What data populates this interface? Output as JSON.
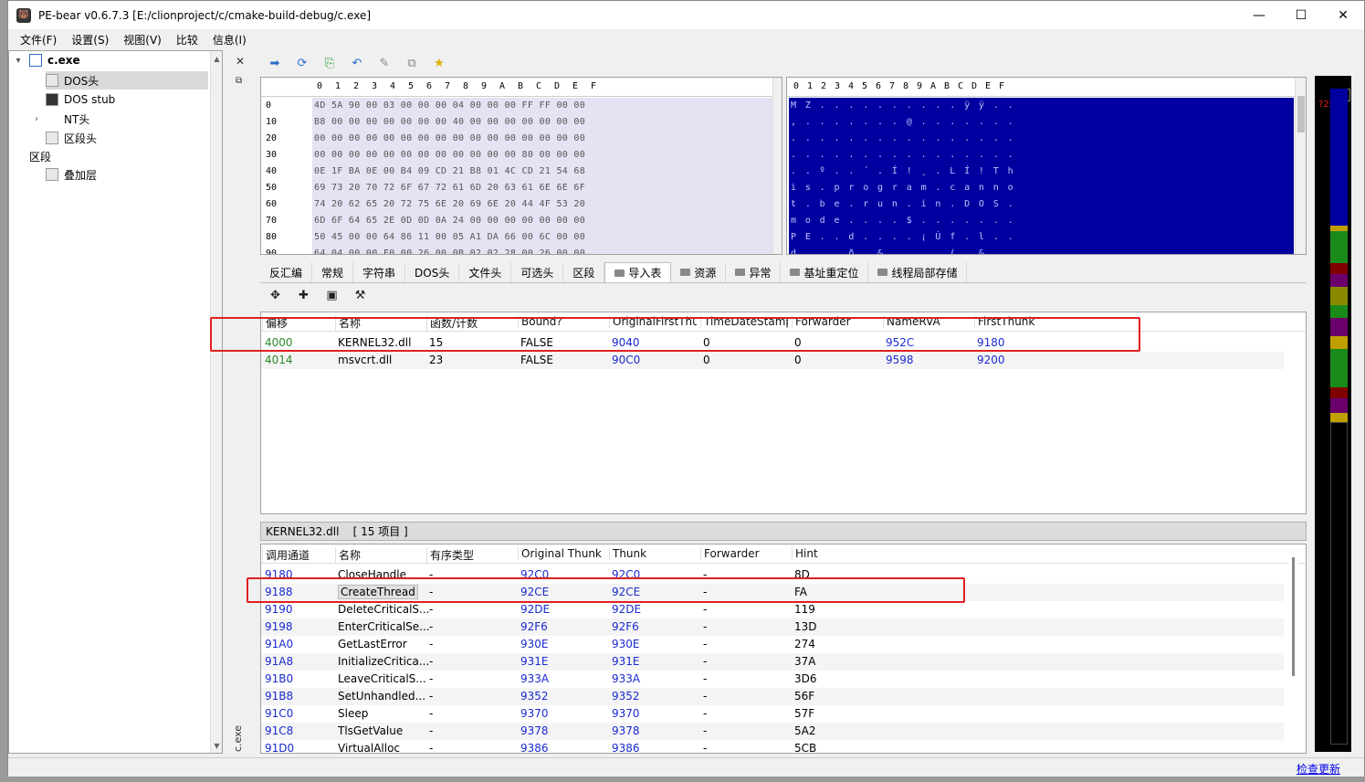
{
  "window": {
    "title": "PE-bear v0.6.7.3 [E:/clionproject/c/cmake-build-debug/c.exe]",
    "minimize": "—",
    "maximize": "☐",
    "close": "✕"
  },
  "menu": [
    "文件(F)",
    "设置(S)",
    "视图(V)",
    "比较",
    "信息(I)"
  ],
  "tree": {
    "root": "c.exe",
    "items": [
      "DOS头",
      "DOS stub",
      "NT头",
      "区段头",
      "区段",
      "叠加层"
    ]
  },
  "side": {
    "vertical_label": "c.exe",
    "close": "✕",
    "float": "⧉"
  },
  "hex": {
    "columns": [
      "0",
      "1",
      "2",
      "3",
      "4",
      "5",
      "6",
      "7",
      "8",
      "9",
      "A",
      "B",
      "C",
      "D",
      "E",
      "F"
    ],
    "rows": [
      {
        "off": "0",
        "bytes": "4D 5A 90 00 03 00 00 00 04 00 00 00 FF FF 00 00",
        "ascii": "M Z . . . . . . . . . . ÿ ÿ . ."
      },
      {
        "off": "10",
        "bytes": "B8 00 00 00 00 00 00 00 40 00 00 00 00 00 00 00",
        "ascii": ", . . . . . . . @ . . . . . . ."
      },
      {
        "off": "20",
        "bytes": "00 00 00 00 00 00 00 00 00 00 00 00 00 00 00 00",
        "ascii": ". . . . . . . . . . . . . . . ."
      },
      {
        "off": "30",
        "bytes": "00 00 00 00 00 00 00 00 00 00 00 00 80 00 00 00",
        "ascii": ". . . . . . . . . . . . . . . ."
      },
      {
        "off": "40",
        "bytes": "0E 1F BA 0E 00 B4 09 CD 21 B8 01 4C CD 21 54 68",
        "ascii": ". . º . . ´ . Í ! ¸ . L Í ! T h"
      },
      {
        "off": "50",
        "bytes": "69 73 20 70 72 6F 67 72 61 6D 20 63 61 6E 6E 6F",
        "ascii": "i s . p r o g r a m . c a n n o"
      },
      {
        "off": "60",
        "bytes": "74 20 62 65 20 72 75 6E 20 69 6E 20 44 4F 53 20",
        "ascii": "t . b e . r u n . i n . D O S ."
      },
      {
        "off": "70",
        "bytes": "6D 6F 64 65 2E 0D 0D 0A 24 00 00 00 00 00 00 00",
        "ascii": "m o d e . . . . $ . . . . . . ."
      },
      {
        "off": "80",
        "bytes": "50 45 00 00 64 86 11 00 05 A1 DA 66 00 6C 00 00",
        "ascii": "P E . . d . . . . ¡ Ú f . l . ."
      },
      {
        "off": "90",
        "bytes": "64 04 00 00 F0 00 26 00 0B 02 02 28 00 26 00 00",
        "ascii": "d . . . ð . & . . . . ( . & . ."
      }
    ]
  },
  "tabs": [
    "反汇编",
    "常规",
    "字符串",
    "DOS头",
    "文件头",
    "可选头",
    "区段",
    "导入表",
    "资源",
    "异常",
    "基址重定位",
    "线程局部存储"
  ],
  "active_tab": "导入表",
  "imports": {
    "headers": [
      "偏移",
      "名称",
      "函数/计数",
      "Bound?",
      "OriginalFirstThu",
      "TimeDateStamp",
      "Forwarder",
      "NameRVA",
      "FirstThunk"
    ],
    "rows": [
      [
        "4000",
        "KERNEL32.dll",
        "15",
        "FALSE",
        "9040",
        "0",
        "0",
        "952C",
        "9180"
      ],
      [
        "4014",
        "msvcrt.dll",
        "23",
        "FALSE",
        "90C0",
        "0",
        "0",
        "9598",
        "9200"
      ]
    ]
  },
  "sub_header": "KERNEL32.dll    [ 15 项目 ]",
  "funcs": {
    "headers": [
      "调用通道",
      "名称",
      "有序类型",
      "Original Thunk",
      "Thunk",
      "Forwarder",
      "Hint"
    ],
    "rows": [
      [
        "9180",
        "CloseHandle",
        "-",
        "92C0",
        "92C0",
        "-",
        "8D"
      ],
      [
        "9188",
        "CreateThread",
        "-",
        "92CE",
        "92CE",
        "-",
        "FA"
      ],
      [
        "9190",
        "DeleteCriticalS...",
        "-",
        "92DE",
        "92DE",
        "-",
        "119"
      ],
      [
        "9198",
        "EnterCriticalSe...",
        "-",
        "92F6",
        "92F6",
        "-",
        "13D"
      ],
      [
        "91A0",
        "GetLastError",
        "-",
        "930E",
        "930E",
        "-",
        "274"
      ],
      [
        "91A8",
        "InitializeCritica...",
        "-",
        "931E",
        "931E",
        "-",
        "37A"
      ],
      [
        "91B0",
        "LeaveCriticalS...",
        "-",
        "933A",
        "933A",
        "-",
        "3D6"
      ],
      [
        "91B8",
        "SetUnhandled...",
        "-",
        "9352",
        "9352",
        "-",
        "56F"
      ],
      [
        "91C0",
        "Sleep",
        "-",
        "9370",
        "9370",
        "-",
        "57F"
      ],
      [
        "91C8",
        "TlsGetValue",
        "-",
        "9378",
        "9378",
        "-",
        "5A2"
      ],
      [
        "91D0",
        "VirtualAlloc",
        "-",
        "9386",
        "9386",
        "-",
        "5CB"
      ]
    ]
  },
  "minimap_label": "?25",
  "status": {
    "link": "检查更新"
  },
  "colors": {
    "offset_green": "#2a8a2a",
    "value_blue": "#1a2ad0",
    "ascii_bg": "#0000a0",
    "highlight_red": "#e02020"
  },
  "icons": [
    "arrow-right-icon",
    "refresh-icon",
    "add-file-icon",
    "undo-icon",
    "pin-icon",
    "compare-icon",
    "star-icon",
    "move-icon",
    "plus-icon",
    "save-icon",
    "wand-icon"
  ]
}
